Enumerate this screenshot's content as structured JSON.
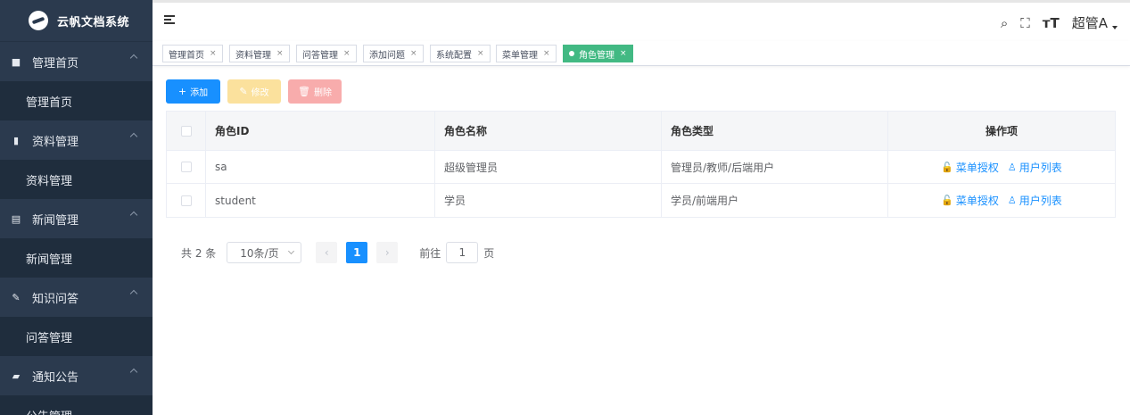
{
  "app": {
    "title": "云帆文档系统"
  },
  "sidebar": {
    "groups": [
      {
        "label": "管理首页",
        "icon": "dashboard-icon",
        "sub": "管理首页"
      },
      {
        "label": "资料管理",
        "icon": "book-icon",
        "sub": "资料管理"
      },
      {
        "label": "新闻管理",
        "icon": "news-icon",
        "sub": "新闻管理"
      },
      {
        "label": "知识问答",
        "icon": "edit-icon",
        "sub": "问答管理"
      },
      {
        "label": "通知公告",
        "icon": "message-icon",
        "sub": "公告管理"
      }
    ]
  },
  "header": {
    "user": "超管A"
  },
  "tags": [
    {
      "label": "管理首页",
      "active": false
    },
    {
      "label": "资料管理",
      "active": false
    },
    {
      "label": "问答管理",
      "active": false
    },
    {
      "label": "添加问题",
      "active": false
    },
    {
      "label": "系统配置",
      "active": false
    },
    {
      "label": "菜单管理",
      "active": false
    },
    {
      "label": "角色管理",
      "active": true
    }
  ],
  "toolbar": {
    "add": "添加",
    "edit": "修改",
    "delete": "删除"
  },
  "table": {
    "headers": {
      "id": "角色ID",
      "name": "角色名称",
      "type": "角色类型",
      "ops": "操作项"
    },
    "rows": [
      {
        "id": "sa",
        "name": "超级管理员",
        "type": "管理员/教师/后端用户",
        "op1": "菜单授权",
        "op2": "用户列表"
      },
      {
        "id": "student",
        "name": "学员",
        "type": "学员/前端用户",
        "op1": "菜单授权",
        "op2": "用户列表"
      }
    ]
  },
  "pagination": {
    "total": "共 2 条",
    "page_size": "10条/页",
    "current": "1",
    "goto_label": "前往",
    "goto_value": "1",
    "page_suffix": "页"
  },
  "colors": {
    "primary": "#1890ff",
    "active_tag": "#42b983",
    "sidebar": "#2b3a4e",
    "sidebar_sub": "#1f2d3d"
  }
}
